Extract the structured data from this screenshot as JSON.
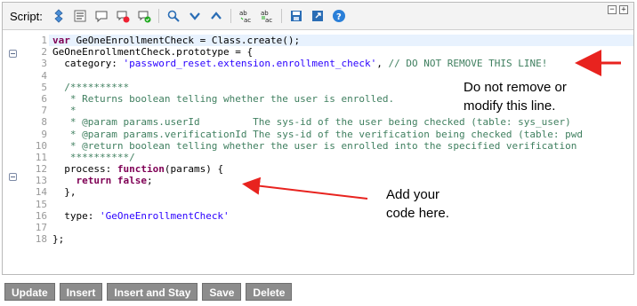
{
  "toolbar": {
    "script_label": "Script:",
    "icons": [
      "syntax-toggle-icon",
      "list-icon",
      "comment-icon",
      "debug-icon",
      "check-icon",
      "search-icon",
      "chevron-down-icon",
      "chevron-up-icon",
      "find-replace-icon",
      "replace-all-icon",
      "save-icon",
      "fullscreen-icon",
      "help-icon"
    ],
    "window_controls": {
      "minimize": "−",
      "maximize": "+"
    }
  },
  "code": {
    "lines": [
      {
        "num": "1",
        "text": "var GeOneEnrollmentCheck = Class.create();"
      },
      {
        "num": "2",
        "text": "GeOneEnrollmentCheck.prototype = {"
      },
      {
        "num": "3",
        "text": "  category: 'password_reset.extension.enrollment_check', // DO NOT REMOVE THIS LINE!"
      },
      {
        "num": "4",
        "text": ""
      },
      {
        "num": "5",
        "text": "  /**********"
      },
      {
        "num": "6",
        "text": "   * Returns boolean telling whether the user is enrolled."
      },
      {
        "num": "7",
        "text": "   *"
      },
      {
        "num": "8",
        "text": "   * @param params.userId         The sys-id of the user being checked (table: sys_user)"
      },
      {
        "num": "9",
        "text": "   * @param params.verificationId The sys-id of the verification being checked (table: pwd"
      },
      {
        "num": "10",
        "text": "   * @return boolean telling whether the user is enrolled into the specified verification"
      },
      {
        "num": "11",
        "text": "   **********/"
      },
      {
        "num": "12",
        "text": "  process: function(params) {"
      },
      {
        "num": "13",
        "text": "    return false;"
      },
      {
        "num": "14",
        "text": "  },"
      },
      {
        "num": "15",
        "text": ""
      },
      {
        "num": "16",
        "text": "  type: 'GeOneEnrollmentCheck'"
      },
      {
        "num": "17",
        "text": ""
      },
      {
        "num": "18",
        "text": "};"
      }
    ]
  },
  "annotations": {
    "top": "Do not remove or\nmodify this line.",
    "bottom": "Add your\ncode here."
  },
  "colors": {
    "arrow": "#e8231f",
    "keyword": "#7f0055",
    "string": "#2a00ff",
    "comment": "#3f7f5f"
  },
  "buttons": {
    "update": "Update",
    "insert": "Insert",
    "insert_and_stay": "Insert and Stay",
    "save": "Save",
    "delete": "Delete"
  }
}
